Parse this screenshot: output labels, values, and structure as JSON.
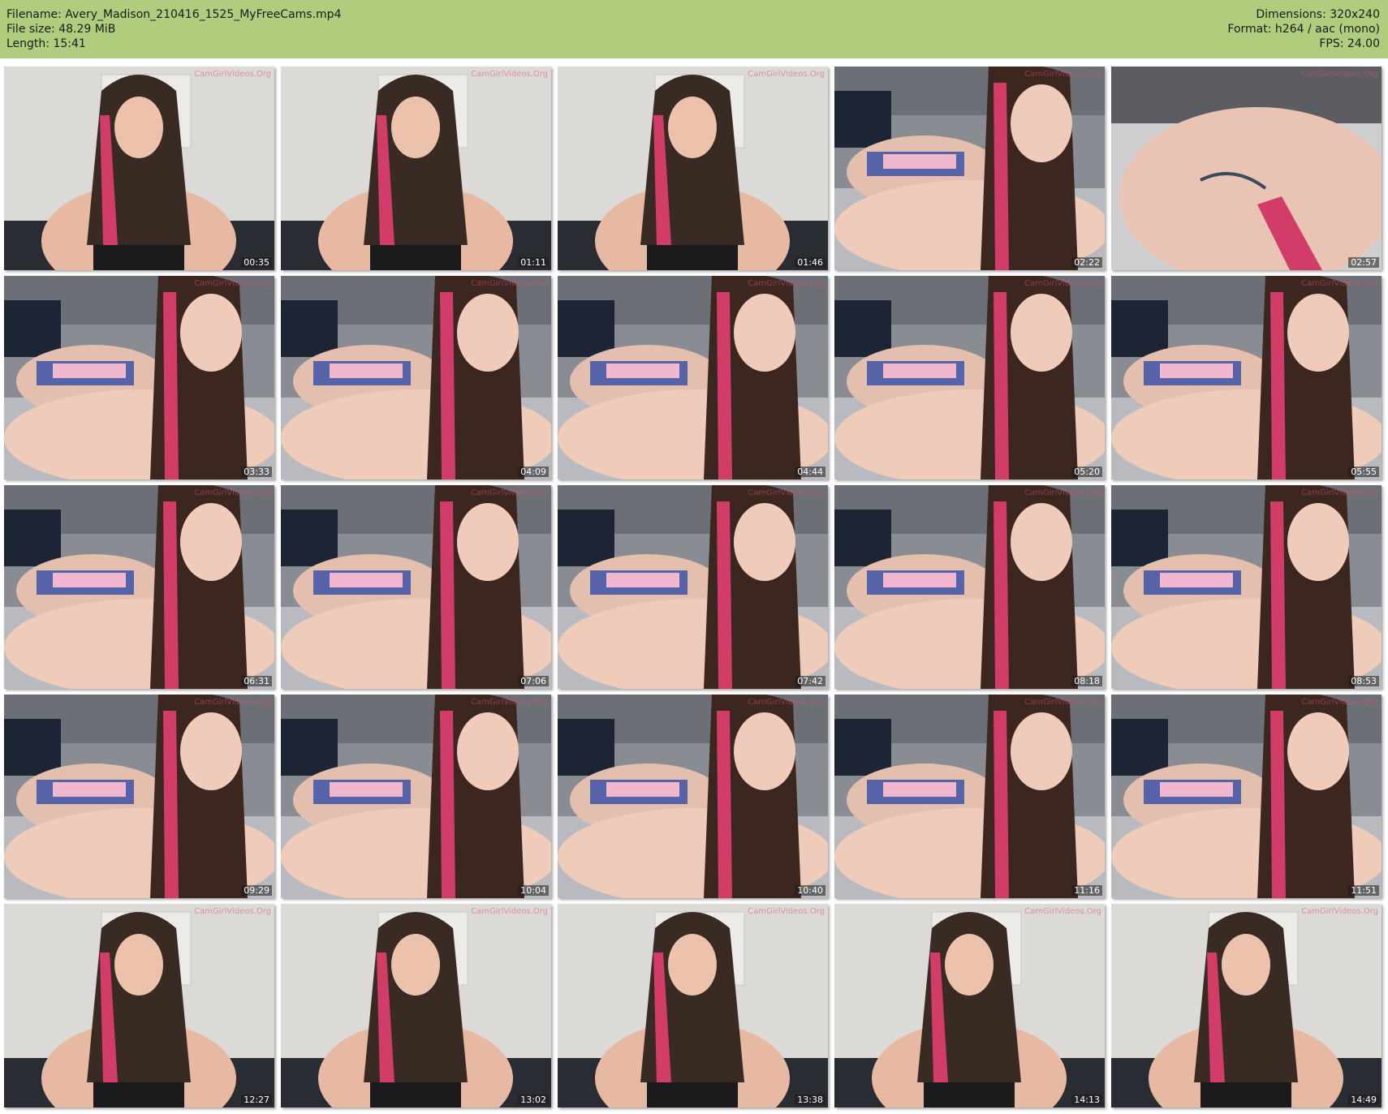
{
  "info": {
    "filename": "Filename: Avery_Madison_210416_1525_MyFreeCams.mp4",
    "filesize": "File size: 48.29 MiB",
    "length": "Length: 15:41",
    "dimensions": "Dimensions: 320x240",
    "format": "Format: h264 / aac (mono)",
    "fps": "FPS: 24.00"
  },
  "colors": {
    "header_bg": "#b0cd7e",
    "hair_highlight": "#d23c68"
  },
  "watermark": "CamGirlVideos.Org",
  "thumbnails": [
    {
      "time": "00:35",
      "scene": "sitting"
    },
    {
      "time": "01:11",
      "scene": "sitting"
    },
    {
      "time": "01:46",
      "scene": "sitting"
    },
    {
      "time": "02:22",
      "scene": "lying"
    },
    {
      "time": "02:57",
      "scene": "closeup"
    },
    {
      "time": "03:33",
      "scene": "lying"
    },
    {
      "time": "04:09",
      "scene": "lying"
    },
    {
      "time": "04:44",
      "scene": "lying"
    },
    {
      "time": "05:20",
      "scene": "lying"
    },
    {
      "time": "05:55",
      "scene": "lying"
    },
    {
      "time": "06:31",
      "scene": "lying"
    },
    {
      "time": "07:06",
      "scene": "lying"
    },
    {
      "time": "07:42",
      "scene": "lying"
    },
    {
      "time": "08:18",
      "scene": "lying"
    },
    {
      "time": "08:53",
      "scene": "lying"
    },
    {
      "time": "09:29",
      "scene": "lying"
    },
    {
      "time": "10:04",
      "scene": "lying"
    },
    {
      "time": "10:40",
      "scene": "lying"
    },
    {
      "time": "11:16",
      "scene": "lying"
    },
    {
      "time": "11:51",
      "scene": "lying"
    },
    {
      "time": "12:27",
      "scene": "sitting"
    },
    {
      "time": "13:02",
      "scene": "sitting"
    },
    {
      "time": "13:38",
      "scene": "sitting"
    },
    {
      "time": "14:13",
      "scene": "sitting"
    },
    {
      "time": "14:49",
      "scene": "sitting"
    }
  ]
}
